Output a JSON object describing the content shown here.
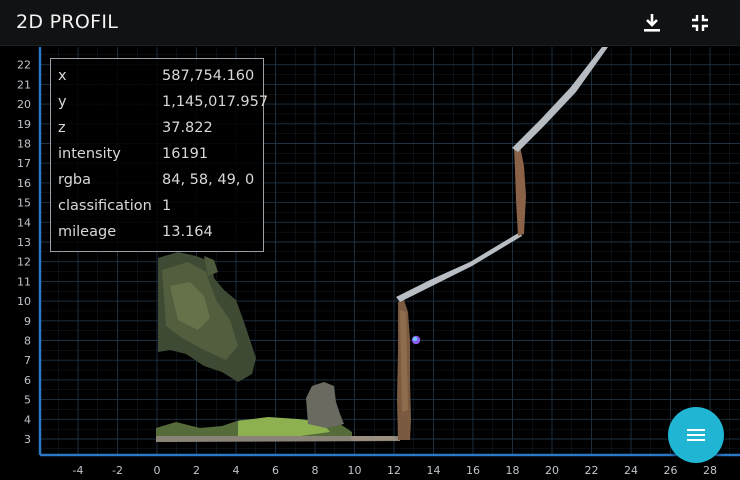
{
  "window": {
    "title": "2D PROFIL"
  },
  "toolbar": {
    "download_icon": "download-icon",
    "collapse_icon": "fullscreen-exit-icon"
  },
  "plot": {
    "background": "#000000",
    "grid_color": "#1e3345",
    "axis_color": "#2a78c6",
    "y_ticks": [
      "3",
      "4",
      "5",
      "6",
      "7",
      "8",
      "9",
      "10",
      "11",
      "12",
      "13",
      "14",
      "15",
      "16",
      "17",
      "18",
      "19",
      "20",
      "21",
      "22"
    ],
    "x_ticks": [
      "-4",
      "-2",
      "0",
      "2",
      "4",
      "6",
      "8",
      "10",
      "12",
      "14",
      "16",
      "18",
      "20",
      "22",
      "24",
      "26",
      "28"
    ]
  },
  "point_info": {
    "rows": [
      {
        "key": "x",
        "value": "587,754.160"
      },
      {
        "key": "y",
        "value": "1,145,017.957"
      },
      {
        "key": "z",
        "value": "37.822"
      },
      {
        "key": "intensity",
        "value": "16191"
      },
      {
        "key": "rgba",
        "value": "84, 58, 49, 0"
      },
      {
        "key": "classification",
        "value": "1"
      },
      {
        "key": "mileage",
        "value": "13.164"
      }
    ]
  },
  "fab": {
    "icon": "menu-icon",
    "color": "#1fb5d3"
  }
}
